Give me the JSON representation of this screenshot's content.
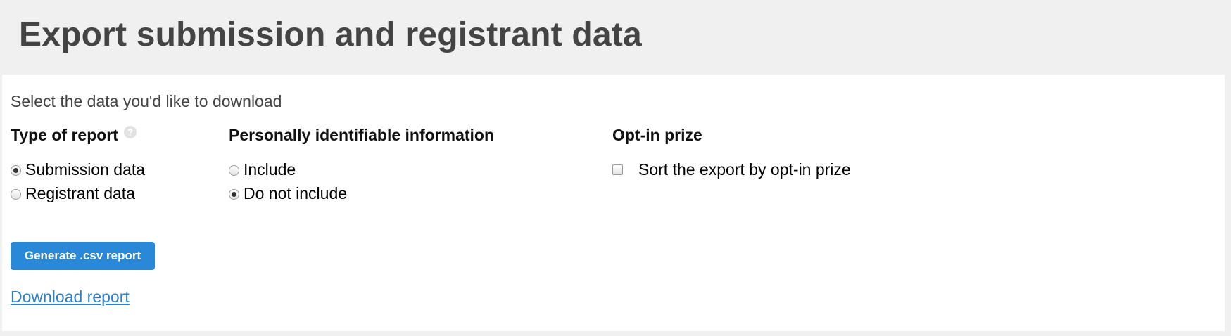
{
  "page": {
    "title": "Export submission and registrant data"
  },
  "form": {
    "intro": "Select the data you'd like to download",
    "report_type": {
      "heading": "Type of report",
      "help_icon": "?",
      "options": [
        {
          "label": "Submission data",
          "checked": true
        },
        {
          "label": "Registrant data",
          "checked": false
        }
      ]
    },
    "pii": {
      "heading": "Personally identifiable information",
      "options": [
        {
          "label": "Include",
          "checked": false
        },
        {
          "label": "Do not include",
          "checked": true
        }
      ]
    },
    "opt_in": {
      "heading": "Opt-in prize",
      "checkbox_label": "Sort the export by opt-in prize",
      "checked": false
    },
    "generate_button": "Generate .csv report",
    "download_link": "Download report"
  },
  "colors": {
    "background": "#f0f0f0",
    "panel": "#ffffff",
    "title_text": "#444444",
    "button": "#2a88d8",
    "link": "#2a7fc8"
  }
}
